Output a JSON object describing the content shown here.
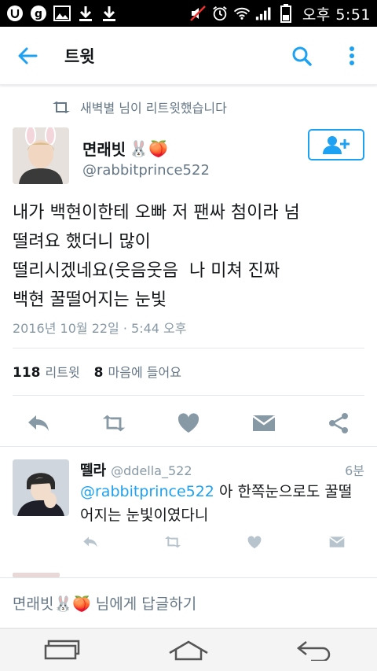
{
  "status_bar": {
    "time": "오후 5:51"
  },
  "app_bar": {
    "title": "트윗"
  },
  "retweet_context": {
    "text": "새벽별 님이 리트윗했습니다"
  },
  "author": {
    "name": "면래빗",
    "name_emoji": "🐰🍑",
    "handle": "@rabbitprince522"
  },
  "tweet": {
    "text": "내가 백현이한테 오빠 저 팬싸 첨이라 넘\n떨려요 했더니 많이\n떨리시겠네요(웃음웃음  나 미쳐 진짜\n백현 꿀떨어지는 눈빛",
    "date": "2016년 10월 22일 · 5:44 오후",
    "retweets_count": "118",
    "retweets_label": "리트윗",
    "likes_count": "8",
    "likes_label": "마음에 들어요"
  },
  "reply": {
    "name": "뗄라",
    "handle": "@ddella_522",
    "time": "6분",
    "mention": "@rabbitprince522",
    "text": " 아 한쪽눈으로도 꿀떨어지는 눈빛이였다니"
  },
  "composer": {
    "placeholder": "면래빗🐰🍑 님에게 답글하기"
  },
  "colors": {
    "accent": "#1da1f2",
    "muted": "#657786",
    "icon": "#8899a6"
  }
}
